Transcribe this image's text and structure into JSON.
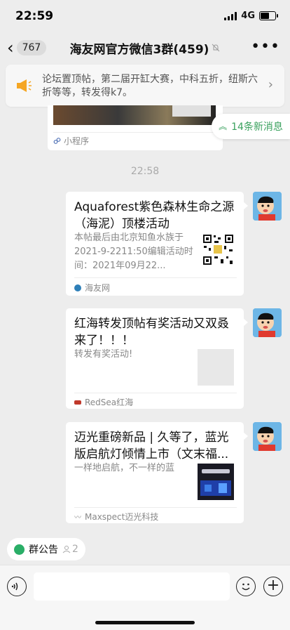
{
  "status": {
    "time": "22:59",
    "network": "4G",
    "battery_level": 0.6
  },
  "nav": {
    "unread": "767",
    "title": "海友网官方微信3群(459)"
  },
  "pin": {
    "text": "论坛置顶帖，第二届开缸大赛，中科五折，纽斯六折等等，转发得k7。"
  },
  "top_card": {
    "source": "小程序"
  },
  "new_messages": {
    "label": "14条新消息"
  },
  "time_separator": "22:58",
  "messages": [
    {
      "title": "Aquaforest紫色森林生命之源（海泥）顶楼活动",
      "desc": "本帖最后由北京知鱼水族于2021-9-2211:50编辑活动时间：2021年09月22...",
      "source": "海友网",
      "source_color": "#2e7fb8"
    },
    {
      "title": "红海转发顶帖有奖活动又双叒来了！！！",
      "desc": "转发有奖活动!",
      "source": "RedSea红海",
      "source_color": "#c0392b"
    },
    {
      "title": "迈光重磅新品 | 久等了，蓝光版启航灯倾情上市（文末福...",
      "desc": "一样地启航，不一样的蓝",
      "source": "Maxspect迈光科技",
      "source_color": "#999999"
    }
  ],
  "announcement": {
    "label": "群公告",
    "count": "2"
  },
  "icons": {
    "back": "chevron-left-icon",
    "mute": "bell-off-icon",
    "more": "more-dots-icon",
    "pin": "megaphone-icon",
    "voice": "voice-icon",
    "emoji": "emoji-icon",
    "plus": "plus-icon"
  },
  "colors": {
    "accent_green": "#3aa15e",
    "announcement_green": "#2aae67",
    "pin_orange": "#f5a623"
  }
}
